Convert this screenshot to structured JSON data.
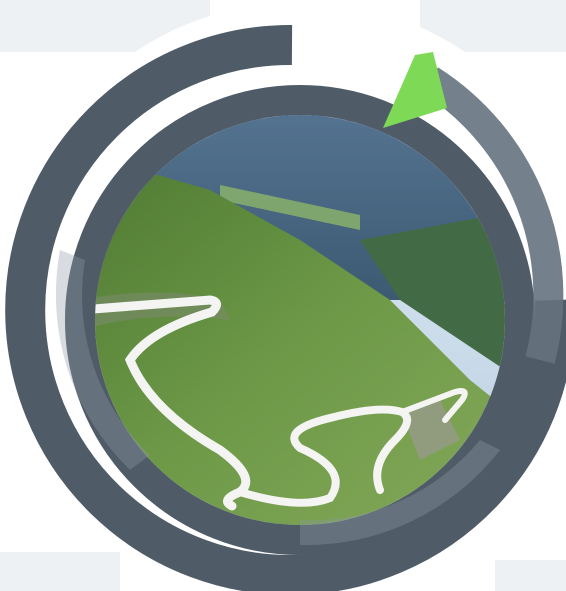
{
  "graphic": {
    "subject": "mountain-pass-road-photo",
    "colors": {
      "background": "#ffffff",
      "band": "#eef1f4",
      "ring_dark": "#4f5c68",
      "ring_mid": "#65727e",
      "ring_light": "#8e99a3",
      "accent": "#7ed957",
      "sky": "#cfe1ef",
      "far_mountain": "#4f6e8e",
      "near_slope": "#5e8a3e",
      "road": "#f4f4f2"
    },
    "accent_progress": 0.04
  }
}
